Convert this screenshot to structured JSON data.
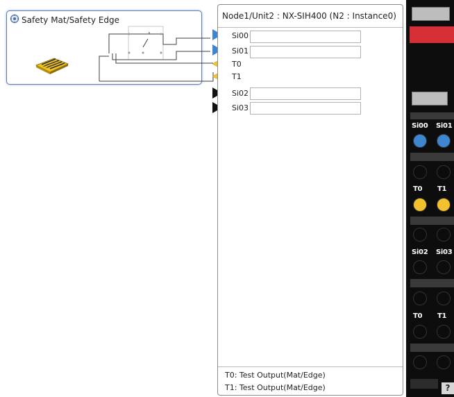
{
  "device_card": {
    "title": "Safety Mat/Safety Edge",
    "icon": "safety-device-icon"
  },
  "unit_panel": {
    "title": "Node1/Unit2 : NX-SIH400 (N2 : Instance0)",
    "ports": [
      {
        "label": "Si00",
        "arrow_color": "#3e86cf",
        "has_field": true,
        "value": ""
      },
      {
        "label": "Si01",
        "arrow_color": "#3e86cf",
        "has_field": true,
        "value": ""
      },
      {
        "label": "T0",
        "arrow_color": "#f2c12e",
        "has_field": false
      },
      {
        "label": "T1",
        "arrow_color": "#f2c12e",
        "has_field": false
      },
      {
        "label": "Si02",
        "arrow_color": "#111111",
        "has_field": true,
        "value": ""
      },
      {
        "label": "Si03",
        "arrow_color": "#111111",
        "has_field": true,
        "value": ""
      }
    ],
    "notes": [
      "T0: Test Output(Mat/Edge)",
      "T1: Test Output(Mat/Edge)"
    ]
  },
  "hardware_panel": {
    "terminal_labels": [
      {
        "left": "Si00",
        "right": "Si01"
      },
      {
        "left": "T0",
        "right": "T1"
      },
      {
        "left": "Si02",
        "right": "Si03"
      },
      {
        "left": "T0",
        "right": "T1"
      }
    ],
    "status_colors": {
      "indicator": "#d62f35",
      "input": "#3e86cf",
      "test_output": "#f2c12e"
    },
    "help_glyph": "?"
  }
}
